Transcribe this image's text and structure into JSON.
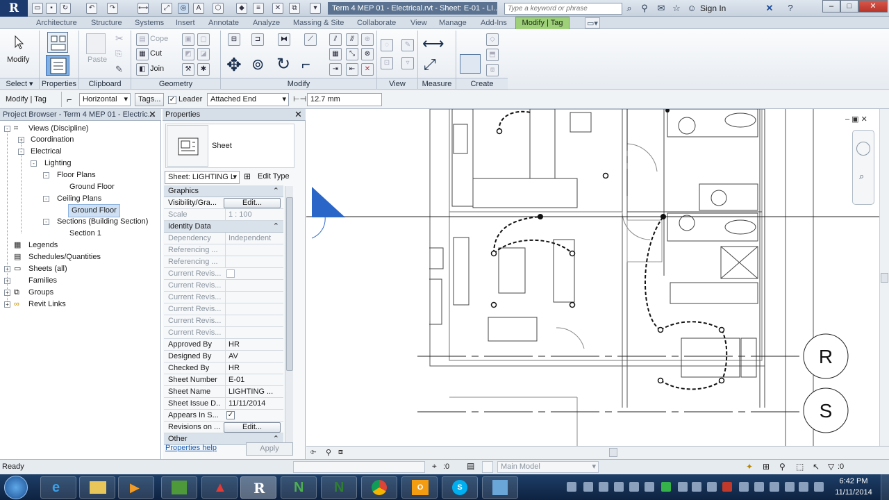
{
  "titlebar": {
    "app_logo": "R",
    "document_title": "Term 4 MEP 01 - Electrical.rvt - Sheet: E-01 - LI...",
    "search_placeholder": "Type a keyword or phrase",
    "sign_in": "Sign In"
  },
  "ribbon": {
    "tabs": [
      "Architecture",
      "Structure",
      "Systems",
      "Insert",
      "Annotate",
      "Analyze",
      "Massing & Site",
      "Collaborate",
      "View",
      "Manage",
      "Add-Ins"
    ],
    "active_tab": "Modify | Tag",
    "modify_label": "Modify",
    "paste_label": "Paste",
    "cope_label": "Cope",
    "cut_label": "Cut",
    "join_label": "Join",
    "properties_label": "Properties",
    "panels": [
      "Select",
      "Properties",
      "Clipboard",
      "Geometry",
      "Modify",
      "View",
      "Measure",
      "Create"
    ]
  },
  "optionsbar": {
    "context": "Modify | Tag",
    "orientation": "Horizontal",
    "tags_button": "Tags...",
    "leader_label": "Leader",
    "leader_checked": true,
    "leader_end": "Attached End",
    "leader_length": "12.7 mm"
  },
  "project_browser": {
    "title": "Project Browser - Term 4 MEP 01 - Electric...",
    "nodes": [
      {
        "label": "Views (Discipline)",
        "exp": "-"
      },
      {
        "label": "Coordination",
        "exp": "+"
      },
      {
        "label": "Electrical",
        "exp": "-"
      },
      {
        "label": "Lighting",
        "exp": "-"
      },
      {
        "label": "Floor Plans",
        "exp": "-"
      },
      {
        "label": "Ground Floor",
        "exp": ""
      },
      {
        "label": "Ceiling Plans",
        "exp": "-"
      },
      {
        "label": "Ground Floor",
        "exp": ""
      },
      {
        "label": "Sections (Building Section)",
        "exp": "-"
      },
      {
        "label": "Section 1",
        "exp": ""
      },
      {
        "label": "Legends",
        "exp": ""
      },
      {
        "label": "Schedules/Quantities",
        "exp": ""
      },
      {
        "label": "Sheets (all)",
        "exp": "+"
      },
      {
        "label": "Families",
        "exp": "+"
      },
      {
        "label": "Groups",
        "exp": "+"
      },
      {
        "label": "Revit Links",
        "exp": "+"
      }
    ]
  },
  "properties": {
    "title": "Properties",
    "type_name": "Sheet",
    "selector": "Sheet: LIGHTING L",
    "edit_type": "Edit Type",
    "sections": {
      "graphics": "Graphics",
      "identity": "Identity Data",
      "other": "Other"
    },
    "vis_name": "Visibility/Gra...",
    "vis_btn": "Edit...",
    "scale_name": "Scale",
    "scale_val": "1 : 100",
    "dependency_name": "Dependency",
    "dependency_val": "Independent",
    "referencing1": "Referencing ...",
    "referencing2": "Referencing ...",
    "current_revis": "Current Revis...",
    "approved_name": "Approved By",
    "approved_val": "HR",
    "designed_name": "Designed By",
    "designed_val": "AV",
    "checked_name": "Checked By",
    "checked_val": "HR",
    "sheet_number_name": "Sheet Number",
    "sheet_number_val": "E-01",
    "sheet_name_name": "Sheet Name",
    "sheet_name_val": "LIGHTING ...",
    "issue_name": "Sheet Issue D...",
    "issue_val": "11/11/2014",
    "appears_name": "Appears In S...",
    "revisions_name": "Revisions on ...",
    "revisions_btn": "Edit...",
    "help_link": "Properties help",
    "apply": "Apply"
  },
  "canvas": {
    "grid_r": "R",
    "grid_s": "S"
  },
  "statusbar": {
    "status": "Ready",
    "filter_count": ":0",
    "model": "Main Model",
    "select_count": ":0"
  },
  "taskbar": {
    "time": "6:42 PM",
    "date": "11/11/2014"
  }
}
